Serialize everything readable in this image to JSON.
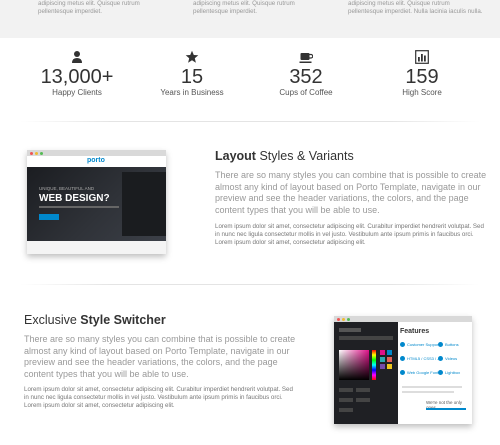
{
  "top_columns": [
    {
      "line1": "adipiscing metus elit. Quisque rutrum",
      "line2": "pellentesque imperdiet."
    },
    {
      "line1": "adipiscing metus elit. Quisque rutrum",
      "line2": "pellentesque imperdiet."
    },
    {
      "line1": "adipiscing metus elit. Quisque rutrum",
      "line2": "pellentesque imperdiet. Nulla lacinia iaculis nulla."
    }
  ],
  "stats": [
    {
      "icon": "user-icon",
      "value": "13,000+",
      "label": "Happy Clients"
    },
    {
      "icon": "star-icon",
      "value": "15",
      "label": "Years in Business"
    },
    {
      "icon": "coffee-icon",
      "value": "352",
      "label": "Cups of Coffee"
    },
    {
      "icon": "bar-chart-icon",
      "value": "159",
      "label": "High Score"
    }
  ],
  "layout_feature": {
    "title_bold": "Layout",
    "title_rest": " Styles & Variants",
    "lead": [
      "There are so many styles you can combine that is possible to create",
      "almost any kind of layout based on Porto Template, navigate in our",
      "preview and see the header variations, the colors, and the page",
      "content types that you will be able to use."
    ],
    "body": [
      "Lorem ipsum dolor sit amet, consectetur adipiscing elit. Curabitur imperdiet hendrerit volutpat. Sed",
      "in nunc nec ligula consectetur mollis in vel justo. Vestibulum ante ipsum primis in faucibus orci.",
      "Lorem ipsum dolor sit amet, consectetur adipiscing elit."
    ],
    "mock": {
      "logo": "porto",
      "small": "UNIQUE, BEAUTIFUL AND",
      "big": "WEB DESIGN?"
    }
  },
  "switcher_feature": {
    "title_rest": "Exclusive ",
    "title_bold": "Style Switcher",
    "lead": [
      "There are so many styles you can combine that is possible to create",
      "almost any kind of layout based on Porto Template, navigate in our",
      "preview and see the header variations, the colors, and the page",
      "content types that you will be able to use."
    ],
    "body": [
      "Lorem ipsum dolor sit amet, consectetur adipiscing elit. Curabitur imperdiet hendrerit volutpat. Sed",
      "in nunc nec ligula consectetur mollis in vel justo. Vestibulum ante ipsum primis in faucibus orci.",
      "Lorem ipsum dolor sit amet, consectetur adipiscing elit."
    ],
    "mock": {
      "heading": "Features",
      "items": [
        "Customer Support",
        "HTML5 / CSS3 / JS",
        "Web Google Fonts",
        "Buttons",
        "Videos",
        "Lightbox"
      ],
      "footer": "We're not the only ones"
    }
  },
  "colors": {
    "accent": "#0088cc",
    "heading": "#333333",
    "muted": "#999999",
    "strip": "#f2f2f2"
  }
}
